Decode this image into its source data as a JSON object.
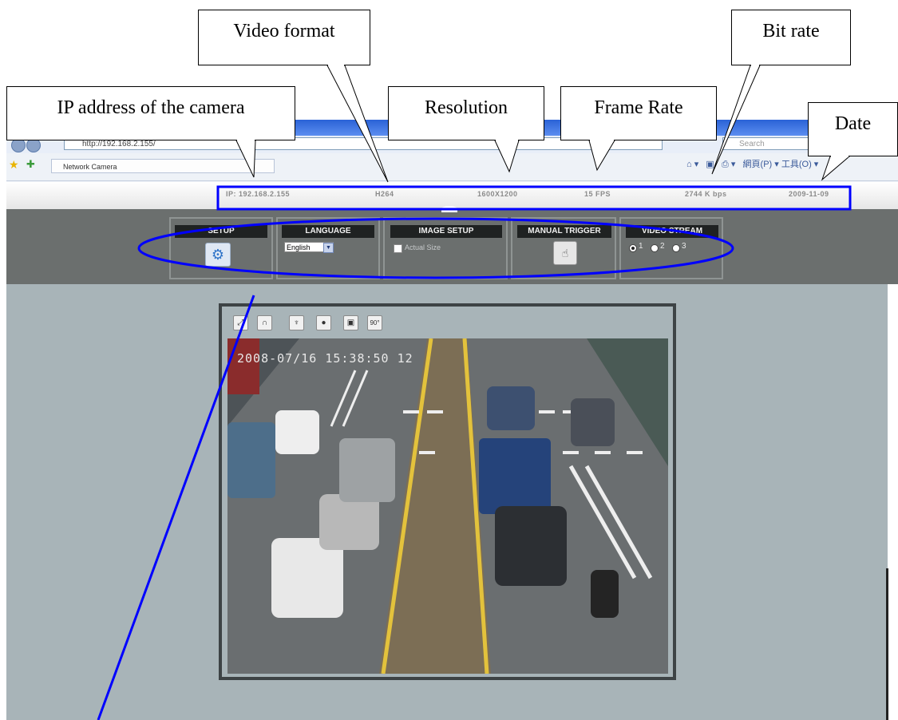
{
  "browser": {
    "address": "http://192.168.2.155/",
    "search_placeholder": "Search",
    "tab_title": "Network Camera",
    "tools_label": "網頁(P) ▾ 工具(O) ▾"
  },
  "info_bar": {
    "ip": "IP: 192.168.2.155",
    "video_format": "H264",
    "resolution": "1600X1200",
    "frame_rate": "15 FPS",
    "bit_rate": "2744 K bps",
    "date": "2009-11-09"
  },
  "panel": {
    "setup": {
      "label": "SETUP",
      "icon": "gear-icon"
    },
    "language": {
      "label": "LANGUAGE",
      "selected": "English"
    },
    "image_setup": {
      "label": "IMAGE SETUP",
      "checkbox_label": "Actual Size",
      "checked": false
    },
    "manual_trigger": {
      "label": "MANUAL TRIGGER",
      "icon": "hand-pointer-icon"
    },
    "video_stream": {
      "label": "VIDEO STREAM",
      "options": [
        "1",
        "2",
        "3"
      ],
      "selected": "1"
    }
  },
  "viewer": {
    "toolbar_icons": [
      "fullscreen-icon",
      "headphone-icon",
      "microphone-icon",
      "record-icon",
      "snapshot-icon",
      "rotate-90-icon"
    ],
    "rotate_label": "90°",
    "timestamp": "2008-07/16 15:38:50 12"
  },
  "callouts": {
    "ip_address": "IP address of the camera",
    "video_format": "Video format",
    "resolution": "Resolution",
    "frame_rate": "Frame Rate",
    "bit_rate": "Bit rate",
    "date": "Date"
  },
  "colors": {
    "annotation": "#0000ff",
    "panel_bg": "#6b6f6e",
    "viewer_bg": "#a8b4b8",
    "box_header": "#1f2222"
  }
}
